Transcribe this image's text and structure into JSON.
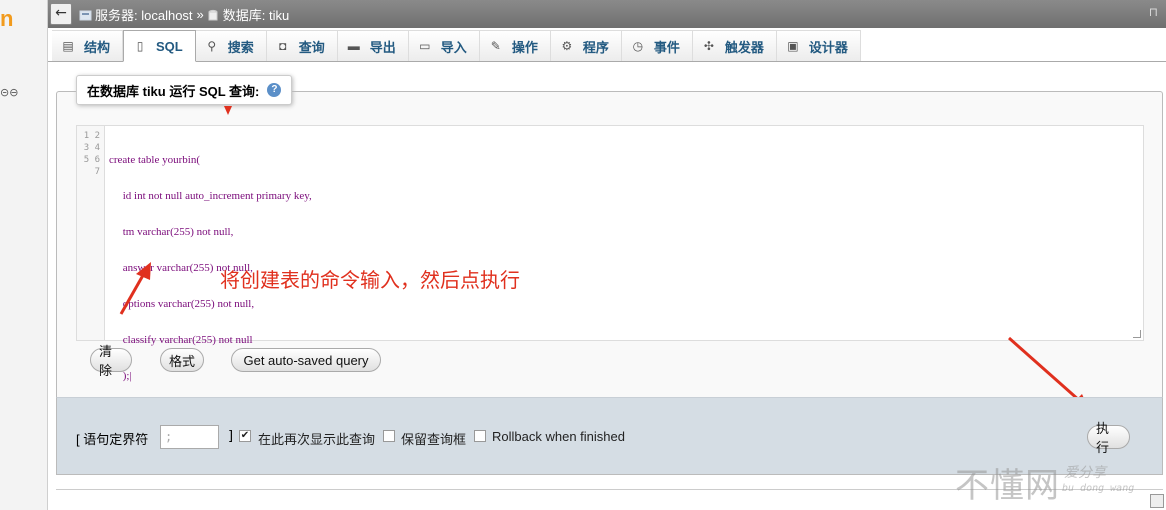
{
  "breadcrumb": {
    "back_icon": "back-arrow-icon",
    "server": "服务器: localhost",
    "separator": "»",
    "database": "数据库: tiku",
    "corner_glyph": "⊓"
  },
  "left_strip": {
    "logo_fragment": "n"
  },
  "tabs": [
    {
      "label": "结构",
      "icon": "structure-icon"
    },
    {
      "label": "SQL",
      "icon": "sql-icon",
      "active": true
    },
    {
      "label": "搜索",
      "icon": "search-icon"
    },
    {
      "label": "查询",
      "icon": "query-icon"
    },
    {
      "label": "导出",
      "icon": "export-icon"
    },
    {
      "label": "导入",
      "icon": "import-icon"
    },
    {
      "label": "操作",
      "icon": "wrench-icon"
    },
    {
      "label": "程序",
      "icon": "routines-icon"
    },
    {
      "label": "事件",
      "icon": "clock-icon"
    },
    {
      "label": "触发器",
      "icon": "triggers-icon"
    },
    {
      "label": "设计器",
      "icon": "designer-icon"
    }
  ],
  "query_box": {
    "legend": "在数据库 tiku 运行 SQL 查询:",
    "help_icon": "help-icon",
    "line_numbers": [
      "1",
      "2",
      "3",
      "4",
      "5",
      "6",
      "7"
    ],
    "code_lines": [
      "create table yourbin(",
      "     id int not null auto_increment primary key,",
      "     tm varchar(255) not null,",
      "     answer varchar(255) not null,",
      "     options varchar(255) not null,",
      "     classify varchar(255) not null",
      "     );|"
    ]
  },
  "annotation": {
    "text": "将创建表的命令输入，然后点执行",
    "color": "#e0301e"
  },
  "buttons": {
    "clear": "清除",
    "format": "格式",
    "auto_saved": "Get auto-saved query",
    "go": "执行"
  },
  "options": {
    "delimiter_label_open": "[ 语句定界符",
    "delimiter_value": ";",
    "delimiter_label_close": "]",
    "show_query_label": "在此再次显示此查询",
    "show_query_checked": true,
    "keep_box_label": "保留查询框",
    "keep_box_checked": false,
    "rollback_label": "Rollback when finished",
    "rollback_checked": false
  },
  "watermark": {
    "main": "不懂网",
    "sub1": "爱分享",
    "sub2": "bu dong wang"
  },
  "colors": {
    "tab_text": "#235a81",
    "breadcrumb_bg": "#7c7c7c",
    "bottom_panel_bg": "#d5dde4",
    "annotation_red": "#e0301e"
  }
}
